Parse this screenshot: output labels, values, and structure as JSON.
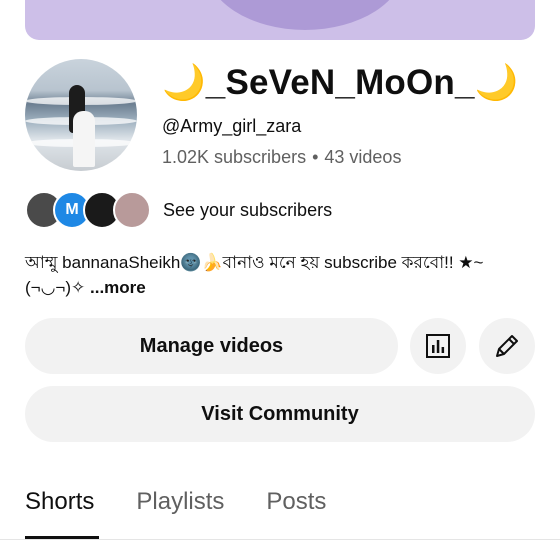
{
  "channel": {
    "moon_left": "🌙",
    "name": "_SeVeN_MoOn_",
    "moon_right": "🌙",
    "handle": "@Army_girl_zara",
    "subscribers": "1.02K subscribers",
    "separator": "•",
    "videos": "43 videos"
  },
  "subscribers_preview": {
    "avatar_letter": "M",
    "link_text": "See your subscribers"
  },
  "description": {
    "text": "আম্মু bannanaSheikh🌚🍌বানাও মনে হয়  subscribe করবো!! ★~(¬◡¬)✧",
    "more": "...more"
  },
  "actions": {
    "manage_label": "Manage videos",
    "analytics_icon": "analytics-icon",
    "edit_icon": "pencil-icon",
    "community_label": "Visit Community"
  },
  "tabs": [
    "Shorts",
    "Playlists",
    "Posts"
  ],
  "colors": {
    "banner": "#cdbfe8",
    "button_bg": "#f2f2f2",
    "secondary_text": "#606060",
    "moon": "#f2c200",
    "blue_avatar": "#1e88e5"
  }
}
